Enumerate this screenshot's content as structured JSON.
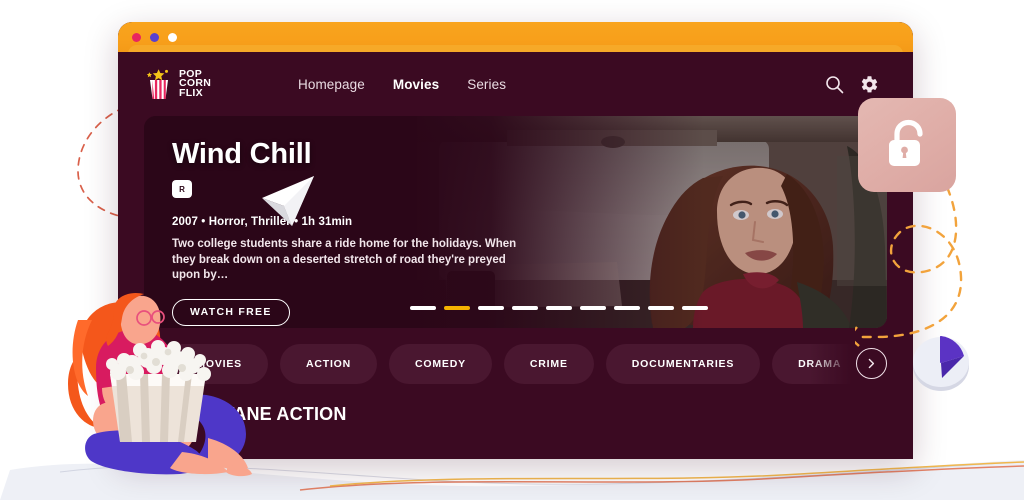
{
  "window": {
    "dots": [
      "close-dot",
      "minimize-dot",
      "maximize-dot"
    ]
  },
  "brand": {
    "line1": "POP",
    "line2": "CORN",
    "line3": "FLIX",
    "icon": "popcorn-logo-icon"
  },
  "nav": {
    "links": [
      {
        "label": "Homepage",
        "active": false
      },
      {
        "label": "Movies",
        "active": true
      },
      {
        "label": "Series",
        "active": false
      }
    ],
    "icons": [
      {
        "name": "search-icon"
      },
      {
        "name": "gear-icon"
      }
    ]
  },
  "hero": {
    "title": "Wind Chill",
    "rating_badge": "R",
    "meta": "2007 • Horror, Thriller • 1h 31min",
    "description": "Two college students share a ride home for the holidays. When they break down on a deserted stretch of road  they're preyed upon by…",
    "watch_button": "WATCH FREE",
    "carousel": {
      "total": 9,
      "active_index": 1
    },
    "artwork_alt": "movie-still-woman-in-car"
  },
  "categories": {
    "items": [
      "ALL MOVIES",
      "ACTION",
      "COMEDY",
      "CRIME",
      "DOCUMENTARIES",
      "DRAMA"
    ],
    "next_icon": "chevron-right-icon"
  },
  "section": {
    "title": "HIGH-OCTANE ACTION"
  },
  "decor": {
    "lock_icon": "unlocked-padlock-icon",
    "play_icon": "play-triangle-icon",
    "cursor_icon": "paper-plane-cursor-icon",
    "illustration": "woman-with-popcorn-illustration"
  },
  "colors": {
    "titlebar_orange": "#f8a01b",
    "app_background": "#3b0a22",
    "hero_background": "#2b0618",
    "category_chip": "#4a1730",
    "accent_gold": "#f5b301",
    "lock_badge_pink": "#dfada7",
    "play_purple": "#5b33c4",
    "dash_orange": "#f2a33c",
    "dash_red": "#d9604a"
  }
}
